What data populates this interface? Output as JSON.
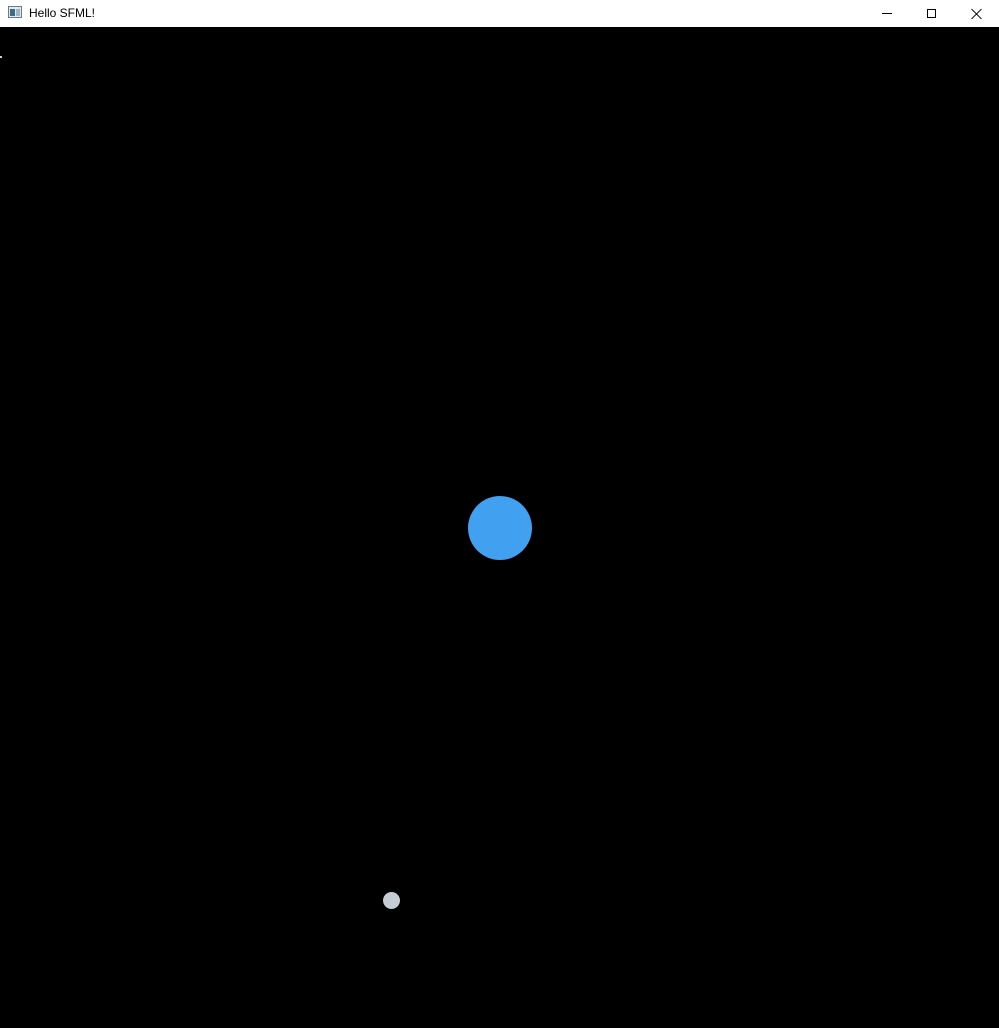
{
  "window": {
    "title": "Hello SFML!",
    "icon": "app-window-icon",
    "controls": {
      "minimize_icon": "minimize-icon",
      "maximize_icon": "maximize-icon",
      "close_icon": "close-icon"
    }
  },
  "scene": {
    "background_color": "#000000",
    "bodies": [
      {
        "role": "planet",
        "color": "#42a0f0"
      },
      {
        "role": "moon",
        "color": "#c5ccd3"
      }
    ]
  }
}
